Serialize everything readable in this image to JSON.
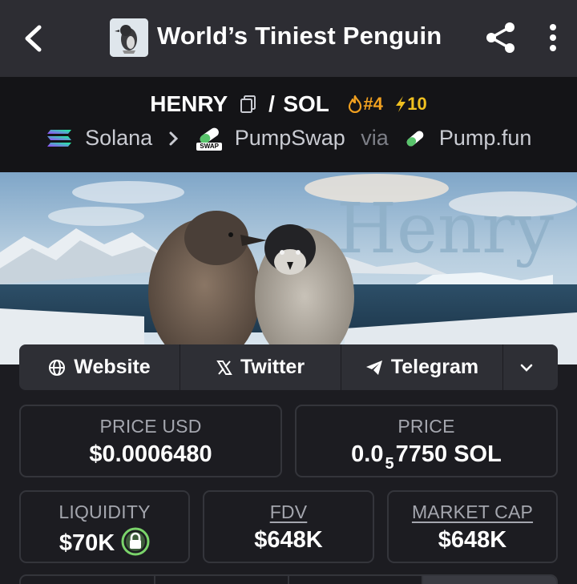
{
  "header": {
    "title": "World’s Tiniest Penguin"
  },
  "pair": {
    "base_symbol": "HENRY",
    "separator": "/",
    "quote_symbol": "SOL",
    "trending_rank": "#4",
    "boosts": "10",
    "chain": "Solana",
    "dex": "PumpSwap",
    "dex_badge": "SWAP",
    "via_label": "via",
    "launchpad": "Pump.fun"
  },
  "banner": {
    "logo_text": "Henry"
  },
  "links": {
    "website": "Website",
    "twitter": "Twitter",
    "telegram": "Telegram"
  },
  "stats": {
    "price_usd_label": "PRICE USD",
    "price_usd_value": "$0.0006480",
    "price_label": "PRICE",
    "price_prefix": "0.0",
    "price_zero_count": "5",
    "price_suffix": "7750 SOL",
    "liquidity_label": "LIQUIDITY",
    "liquidity_value": "$70K",
    "fdv_label": "FDV",
    "fdv_value": "$648K",
    "mcap_label": "MARKET CAP",
    "mcap_value": "$648K"
  },
  "colors": {
    "accent_orange": "#f0a020",
    "lock_green": "#7ad36a",
    "card_border": "#34353b"
  }
}
